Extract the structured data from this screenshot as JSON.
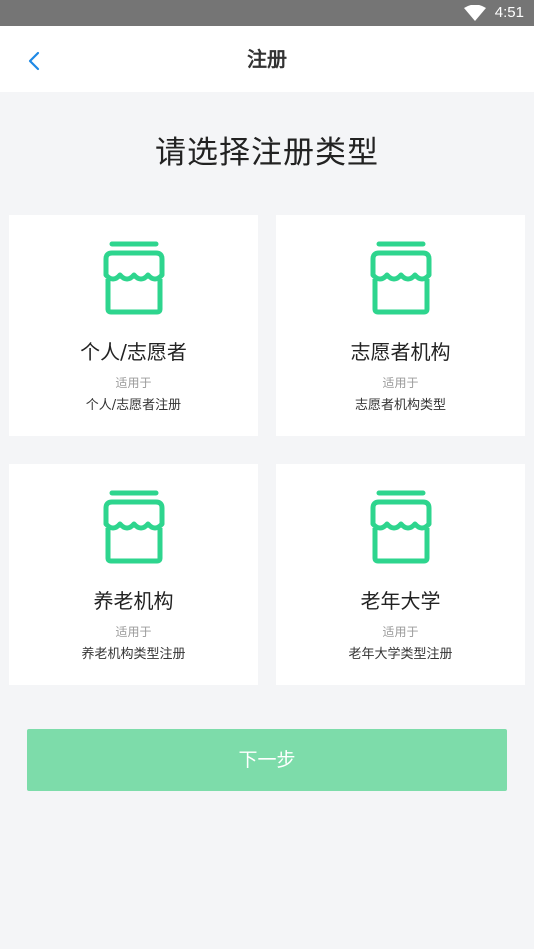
{
  "status_bar": {
    "time": "4:51",
    "wifi_icon": "wifi-icon"
  },
  "nav": {
    "back_icon": "chevron-left-icon",
    "title": "注册"
  },
  "heading": "请选择注册类型",
  "cards": [
    {
      "name": "个人/志愿者",
      "sub": "适用于",
      "desc": "个人/志愿者注册",
      "icon": "shop-icon"
    },
    {
      "name": "志愿者机构",
      "sub": "适用于",
      "desc": "志愿者机构类型",
      "icon": "shop-icon"
    },
    {
      "name": "养老机构",
      "sub": "适用于",
      "desc": "养老机构类型注册",
      "icon": "shop-icon"
    },
    {
      "name": "老年大学",
      "sub": "适用于",
      "desc": "老年大学类型注册",
      "icon": "shop-icon"
    }
  ],
  "next_button": {
    "label": "下一步"
  },
  "colors": {
    "accent": "#2ed58e",
    "button": "#7ddcaa",
    "back_arrow": "#1e88e5",
    "background": "#f4f5f7"
  }
}
